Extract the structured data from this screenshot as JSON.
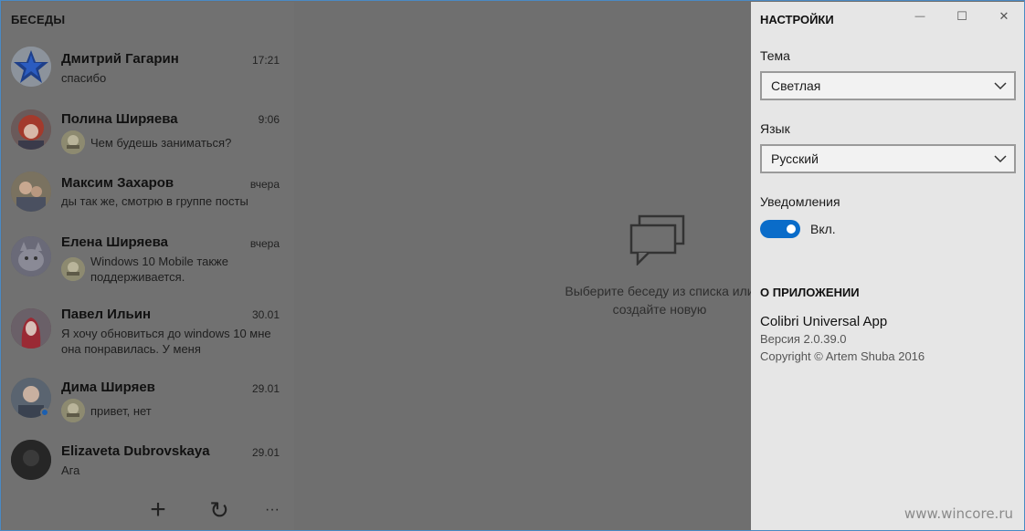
{
  "conversations": {
    "title": "БЕСЕДЫ",
    "items": [
      {
        "name": "Дмитрий Гагарин",
        "time": "17:21",
        "preview": "спасибо"
      },
      {
        "name": "Полина Ширяева",
        "time": "9:06",
        "preview": "Чем будешь заниматься?"
      },
      {
        "name": "Максим Захаров",
        "time": "вчера",
        "preview": "ды так же, смотрю в группе посты"
      },
      {
        "name": "Елена Ширяева",
        "time": "вчера",
        "preview": "Windows 10 Mobile также поддерживается."
      },
      {
        "name": "Павел Ильин",
        "time": "30.01",
        "preview": "Я хочу обновиться до windows 10 мне она понравилась. У меня"
      },
      {
        "name": "Дима Ширяев",
        "time": "29.01",
        "preview": "привет, нет"
      },
      {
        "name": "Elizaveta Dubrovskaya",
        "time": "29.01",
        "preview": "Ага"
      }
    ],
    "toolbar": {
      "add": "+",
      "refresh": "↻",
      "more": "···"
    }
  },
  "center": {
    "empty_text": "Выберите беседу из списка или создайте новую"
  },
  "settings": {
    "title": "НАСТРОЙКИ",
    "theme_label": "Тема",
    "theme_value": "Светлая",
    "language_label": "Язык",
    "language_value": "Русский",
    "notifications_label": "Уведомления",
    "notifications_state": "Вкл.",
    "about_title": "О ПРИЛОЖЕНИИ",
    "app_name": "Colibri Universal App",
    "version": "Версия 2.0.39.0",
    "copyright": "Copyright © Artem Shuba 2016"
  },
  "window_controls": {
    "minimize": "—",
    "maximize": "☐",
    "close": "✕"
  },
  "watermark": "www.wincore.ru",
  "colors": {
    "accent": "#0a6cc9",
    "overlay": "#717171",
    "settings_bg": "#e6e6e6"
  }
}
